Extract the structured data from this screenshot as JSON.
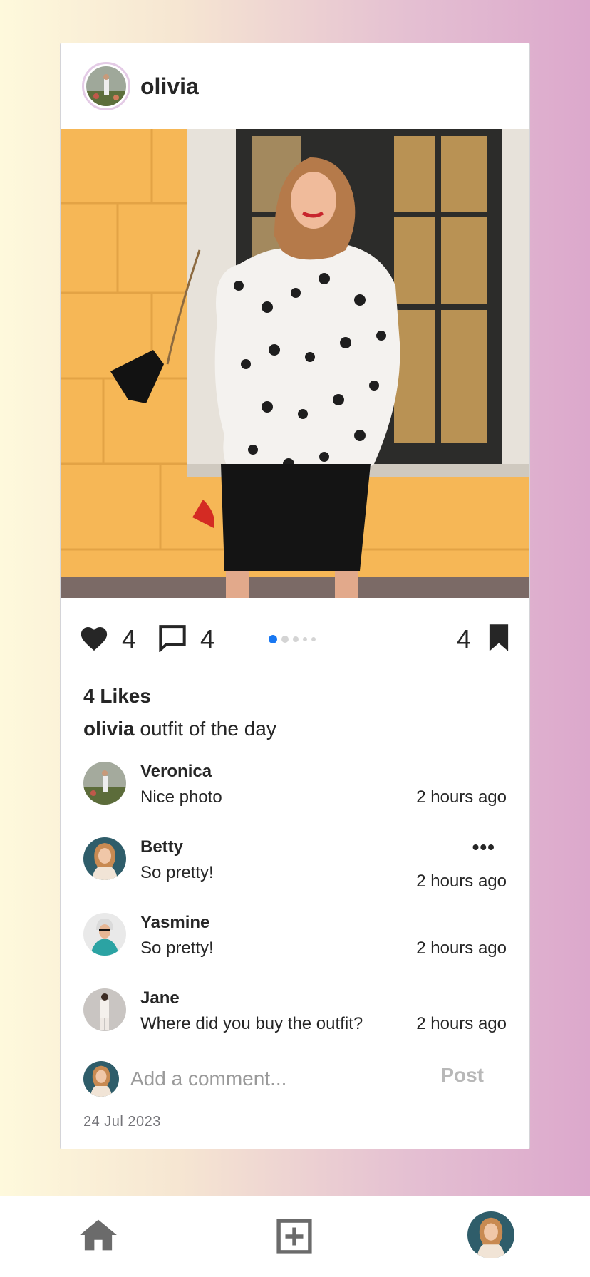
{
  "post": {
    "username": "olivia",
    "likes_count": "4",
    "comments_count": "4",
    "saves_count": "4",
    "likes_label": "4 Likes",
    "caption_user": "olivia",
    "caption_text": "outfit of the day",
    "date": "24 Jul 2023",
    "carousel": {
      "total": 5,
      "active": 0
    }
  },
  "comments": [
    {
      "name": "Veronica",
      "text": "Nice photo",
      "time": "2 hours ago"
    },
    {
      "name": "Betty",
      "text": "So pretty!",
      "time": "2 hours ago",
      "more": "•••"
    },
    {
      "name": "Yasmine",
      "text": "So pretty!",
      "time": "2 hours ago"
    },
    {
      "name": "Jane",
      "text": "Where did you buy the outfit?",
      "time": "2 hours ago"
    }
  ],
  "add_comment": {
    "placeholder": "Add a comment...",
    "post_label": "Post"
  },
  "nav": {
    "home_icon": "home-icon",
    "add_icon": "add-square-icon",
    "profile_icon": "profile-avatar"
  },
  "colors": {
    "accent_dot": "#1877f2",
    "text": "#262626",
    "muted": "#9a9a9a"
  }
}
